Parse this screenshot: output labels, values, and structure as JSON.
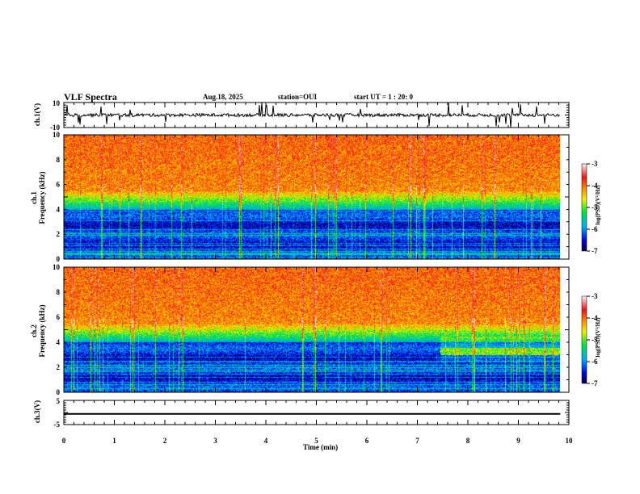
{
  "header": {
    "title": "VLF Spectra",
    "date": "Aug.18, 2025",
    "station": "station=OUI",
    "start": "start  UT =   1 : 20: 0"
  },
  "chart_data": [
    {
      "type": "line",
      "panel": "ch1",
      "ylabel": "ch.1(V)",
      "ylim": [
        -10,
        10
      ],
      "yticks": [
        "10",
        "-10"
      ],
      "xlim": [
        0,
        10
      ],
      "note_data": "noisy waveform around 0 V with impulsive spikes reaching ±10 V"
    },
    {
      "type": "heatmap",
      "panel": "ch1-spectrogram",
      "ylabel": "ch.1\nFrequency (kHz)",
      "ylim": [
        0,
        10
      ],
      "yticks": [
        "0",
        "2",
        "4",
        "6",
        "8",
        "10"
      ],
      "xlim": [
        0,
        10
      ],
      "data_end_min": 9.83,
      "colorbar": {
        "label": "log(PSD)(V²/Hz)",
        "range": [
          -7,
          -3
        ],
        "ticks": [
          "-3",
          "-4",
          "-5",
          "-6",
          "-7"
        ]
      }
    },
    {
      "type": "heatmap",
      "panel": "ch2-spectrogram",
      "ylabel": "ch.2\nFrequency (kHz)",
      "ylim": [
        0,
        10
      ],
      "yticks": [
        "0",
        "2",
        "4",
        "6",
        "8",
        "10"
      ],
      "xlim": [
        0,
        10
      ],
      "data_end_min": 9.83,
      "colorbar": {
        "label": "log(PSD)(V²/Hz)",
        "range": [
          -7,
          -3
        ],
        "ticks": [
          "-3",
          "-4",
          "-5",
          "-6",
          "-7"
        ]
      }
    },
    {
      "type": "line",
      "panel": "ch3",
      "ylabel": "ch.3(V)",
      "ylim": [
        -5,
        5
      ],
      "yticks": [
        "5",
        "-5"
      ],
      "constant_value": -0.6,
      "xlim": [
        0,
        10
      ],
      "xlabel": "Time  (min)",
      "xticks": [
        "0",
        "1",
        "2",
        "3",
        "4",
        "5",
        "6",
        "7",
        "8",
        "9",
        "10"
      ]
    }
  ]
}
